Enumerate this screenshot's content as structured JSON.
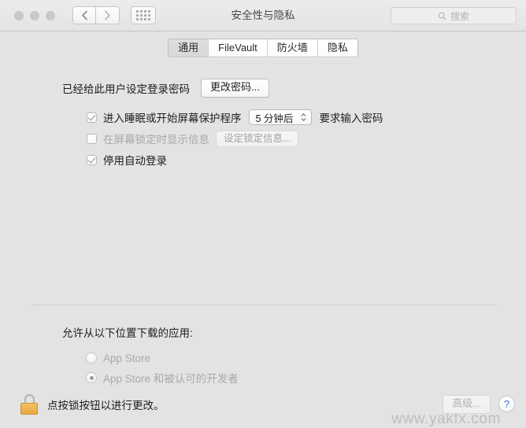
{
  "window": {
    "title": "安全性与隐私",
    "traffic_lights": [
      "close-button",
      "minimize-button",
      "zoom-button"
    ],
    "nav": {
      "back_icon": "chevron-left-icon",
      "forward_icon": "chevron-right-icon"
    },
    "grid_button_icon": "grid-view-icon"
  },
  "search": {
    "icon": "search-icon",
    "placeholder": "搜索",
    "value": ""
  },
  "tabs": [
    {
      "label": "通用",
      "selected": true
    },
    {
      "label": "FileVault",
      "selected": false
    },
    {
      "label": "防火墙",
      "selected": false
    },
    {
      "label": "隐私",
      "selected": false
    }
  ],
  "password_section": {
    "label": "已经给此用户设定登录密码",
    "change_button": "更改密码..."
  },
  "options": [
    {
      "name": "require-password-after-sleep",
      "checked": true,
      "label": "进入睡眠或开始屏幕保护程序",
      "popup_value": "5 分钟后",
      "suffix_label": "要求输入密码"
    },
    {
      "name": "show-message-when-locked",
      "checked": false,
      "label": "在屏幕锁定时显示信息",
      "button_label": "设定锁定信息...",
      "button_disabled": true
    },
    {
      "name": "disable-automatic-login",
      "checked": true,
      "label": "停用自动登录"
    }
  ],
  "download_section": {
    "title": "允许从以下位置下载的应用:",
    "options": [
      {
        "label": "App Store",
        "selected": false
      },
      {
        "label": "App Store 和被认可的开发者",
        "selected": true
      }
    ]
  },
  "watermark": "www.yakfx.com",
  "footer": {
    "lock_icon": "lock-closed-icon",
    "text": "点按锁按钮以进行更改。",
    "advanced_button": "高级...",
    "help_button": "?"
  },
  "colors": {
    "window_bg": "#e3e3e3",
    "titlebar_bg": "#ececec",
    "accent_help": "#3b79c9",
    "lock_gold": "#e8a83e",
    "text": "#1e1e1e",
    "disabled_text": "#a9a9a9"
  }
}
